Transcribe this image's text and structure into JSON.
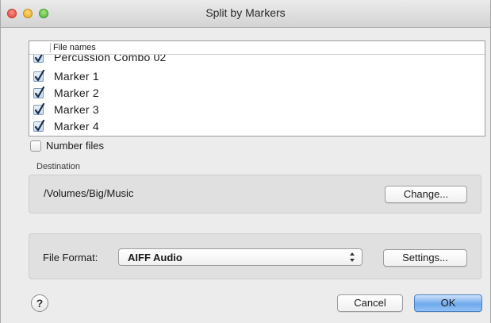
{
  "window": {
    "title": "Split by Markers"
  },
  "file_list": {
    "header": "File names",
    "rows": [
      {
        "label": "Percussion Combo 02",
        "checked": true
      },
      {
        "label": "Marker 1",
        "checked": true
      },
      {
        "label": "Marker 2",
        "checked": true
      },
      {
        "label": "Marker 3",
        "checked": true
      },
      {
        "label": "Marker 4",
        "checked": true
      }
    ]
  },
  "number_files": {
    "label": "Number files",
    "checked": false
  },
  "destination": {
    "label": "Destination",
    "path": "/Volumes/Big/Music",
    "change_label": "Change..."
  },
  "format": {
    "label": "File Format:",
    "selected": "AIFF Audio",
    "settings_label": "Settings..."
  },
  "footer": {
    "help_label": "?",
    "cancel_label": "Cancel",
    "ok_label": "OK"
  },
  "colors": {
    "accent": "#6fa9ec",
    "window_bg": "#ececec"
  }
}
